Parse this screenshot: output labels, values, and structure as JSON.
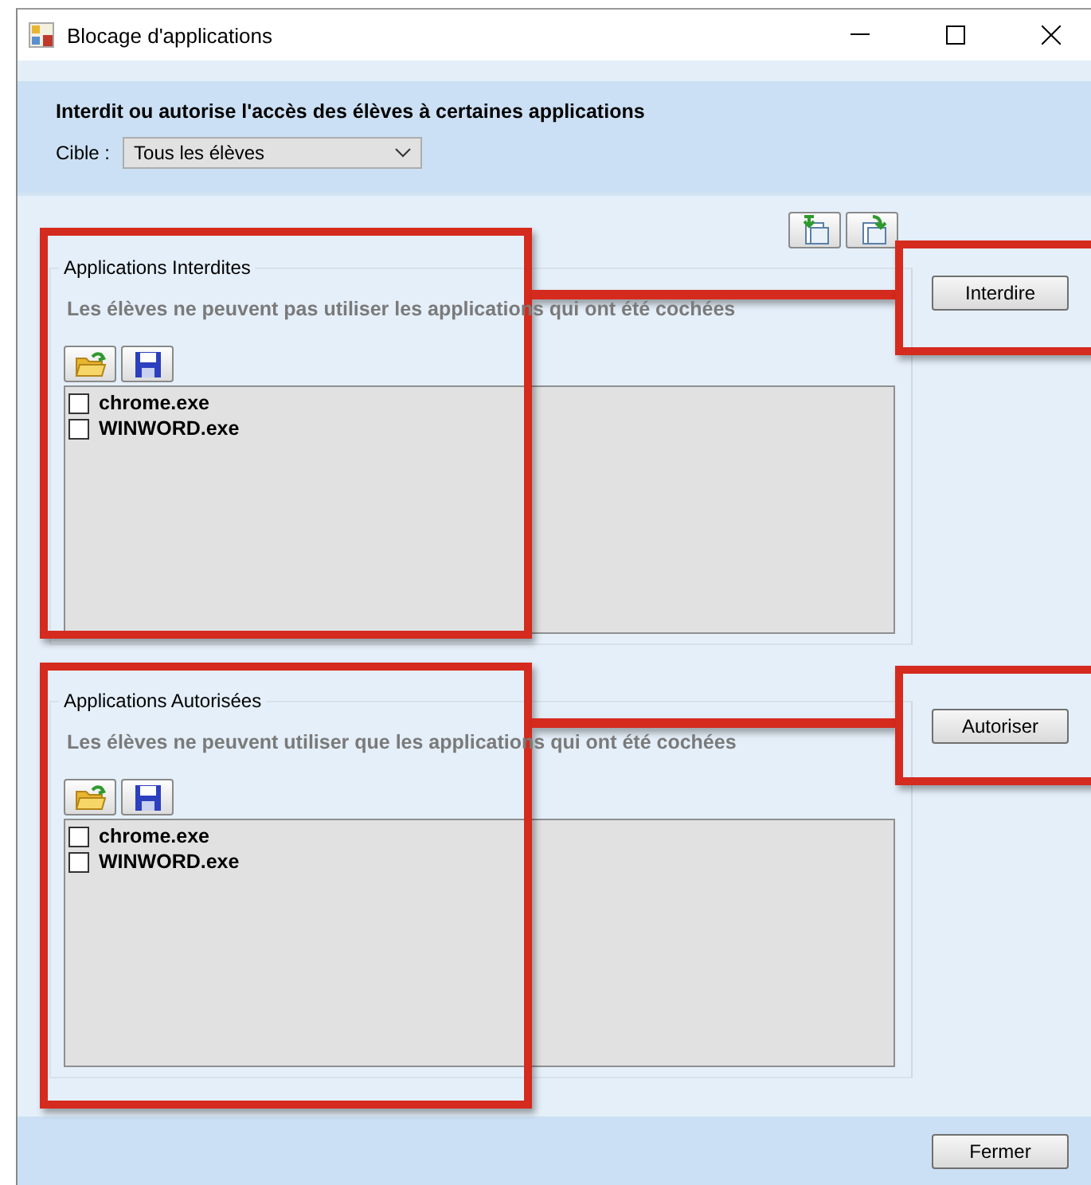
{
  "window": {
    "title": "Blocage d'applications"
  },
  "header": {
    "heading": "Interdit ou autorise l'accès des élèves à certaines applications",
    "target_label": "Cible :",
    "target_value": "Tous les élèves"
  },
  "sections": [
    {
      "title": "Applications Interdites",
      "description": "Les élèves ne peuvent pas utiliser les applications qui ont été cochées",
      "action": "Interdire",
      "highlighted": true,
      "items": [
        {
          "name": "chrome.exe",
          "checked": false
        },
        {
          "name": "WINWORD.exe",
          "checked": false
        }
      ]
    },
    {
      "title": "Applications Autorisées",
      "description": "Les élèves ne peuvent utiliser que les applications qui ont été cochées",
      "action": "Autoriser",
      "highlighted": true,
      "items": [
        {
          "name": "chrome.exe",
          "checked": false
        },
        {
          "name": "WINWORD.exe",
          "checked": false
        }
      ]
    }
  ],
  "footer": {
    "close": "Fermer"
  }
}
